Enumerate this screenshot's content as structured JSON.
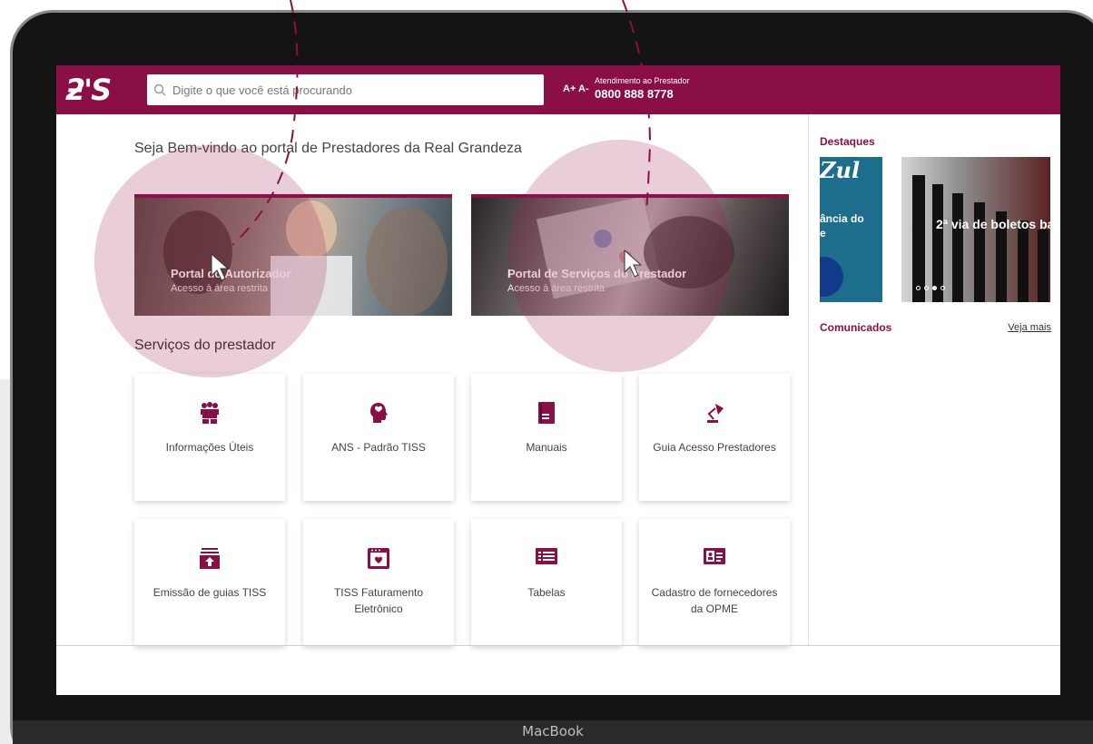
{
  "header": {
    "logo": "ƻ'S",
    "search_placeholder": "Digite o que você está procurando",
    "font_size_controls": "A+ A-",
    "support_label": "Atendimento ao Prestador",
    "support_phone": "0800 888 8778"
  },
  "main": {
    "welcome": "Seja Bem-vindo ao portal de Prestadores da Real Grandeza",
    "banners": [
      {
        "title": "Portal do Autorizador",
        "subtitle": "Acesso à área restrita"
      },
      {
        "title": "Portal de Serviços do Prestador",
        "subtitle": "Acesso à área restrita"
      }
    ],
    "services_title": "Serviços do prestador",
    "services": [
      {
        "label": "Informações Úteis",
        "icon": "people-group-icon"
      },
      {
        "label": "ANS - Padrão TISS",
        "icon": "head-heart-icon"
      },
      {
        "label": "Manuais",
        "icon": "book-icon"
      },
      {
        "label": "Guia Acesso Prestadores",
        "icon": "desk-lamp-icon"
      },
      {
        "label": "Emissão de guias TISS",
        "icon": "upload-tray-icon"
      },
      {
        "label": "TISS Faturamento Eletrônico",
        "icon": "calendar-heart-icon"
      },
      {
        "label": "Tabelas",
        "icon": "list-icon"
      },
      {
        "label": "Cadastro de fornecedores da OPME",
        "icon": "id-card-icon"
      }
    ]
  },
  "sidebar": {
    "highlights_title": "Destaques",
    "slide1_brand": "Zul",
    "slide1_text": "ância do\ne",
    "slide2_text": "2ª via de boletos ba",
    "news_title": "Comunicados",
    "see_more": "Veja mais"
  },
  "device_label": "MacBook",
  "colors": {
    "brand": "#8a0f47",
    "halo": "#9c1a50"
  }
}
